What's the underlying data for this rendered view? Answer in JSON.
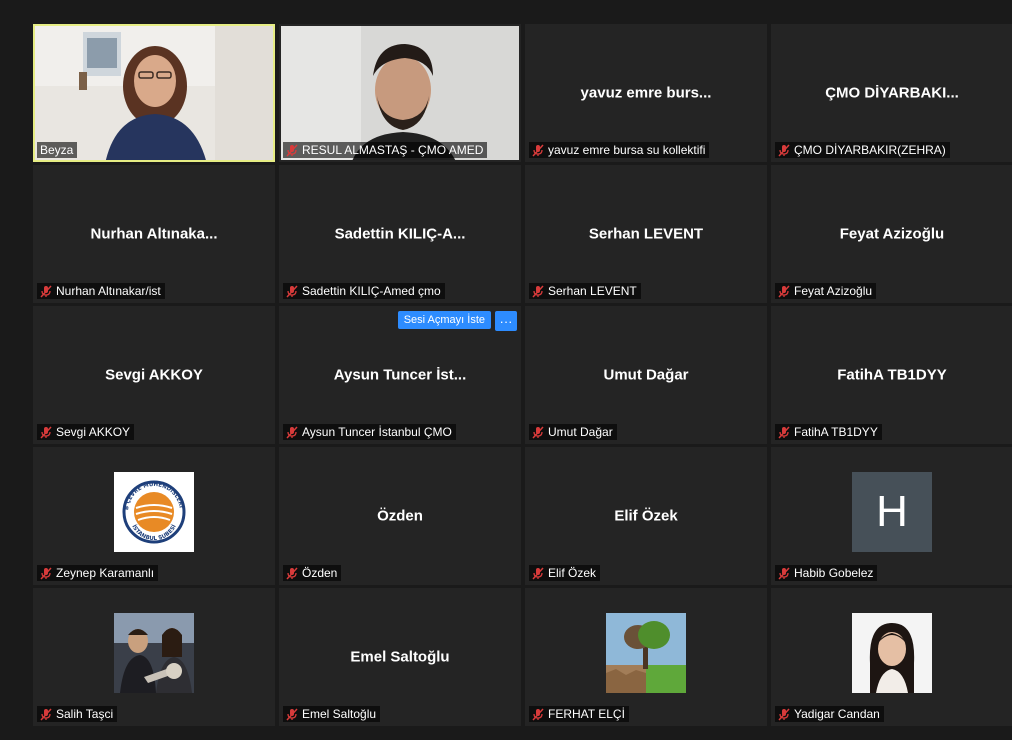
{
  "active_speaker_color": "#e6ed84",
  "accent_color": "#2d8cff",
  "mic_muted_color": "#d83b3b",
  "tiles": [
    {
      "id": "t0",
      "center": "",
      "label": "Beyza",
      "muted": false,
      "kind": "video-woman"
    },
    {
      "id": "t1",
      "center": "",
      "label": "RESUL ALMASTAŞ - ÇMO AMED",
      "muted": true,
      "kind": "video-man"
    },
    {
      "id": "t2",
      "center": "yavuz emre burs...",
      "label": "yavuz emre bursa su kollektifi",
      "muted": true
    },
    {
      "id": "t3",
      "center": "ÇMO  DİYARBAKI...",
      "label": "ÇMO DİYARBAKIR(ZEHRA)",
      "muted": true
    },
    {
      "id": "t4",
      "center": "Nurhan  Altınaka...",
      "label": "Nurhan Altınakar/ist",
      "muted": true
    },
    {
      "id": "t5",
      "center": "Sadettin  KILIÇ-A...",
      "label": "Sadettin KILIÇ-Amed çmo",
      "muted": true
    },
    {
      "id": "t6",
      "center": "Serhan LEVENT",
      "label": "Serhan LEVENT",
      "muted": true
    },
    {
      "id": "t7",
      "center": "Feyat Azizoğlu",
      "label": "Feyat Azizoğlu",
      "muted": true
    },
    {
      "id": "t8",
      "center": "Sevgi AKKOY",
      "label": "Sevgi AKKOY",
      "muted": true
    },
    {
      "id": "t9",
      "center": "Aysun Tuncer  İst...",
      "label": "Aysun Tuncer İstanbul ÇMO",
      "muted": true
    },
    {
      "id": "t10",
      "center": "Umut Dağar",
      "label": "Umut Dağar",
      "muted": true
    },
    {
      "id": "t11",
      "center": "FatihA TB1DYY",
      "label": "FatihA TB1DYY",
      "muted": true
    },
    {
      "id": "t12",
      "center": "",
      "label": "Zeynep Karamanlı",
      "muted": true,
      "kind": "logo"
    },
    {
      "id": "t13",
      "center": "Özden",
      "label": "Özden",
      "muted": true
    },
    {
      "id": "t14",
      "center": "Elif Özek",
      "label": "Elif Özek",
      "muted": true
    },
    {
      "id": "t15",
      "center": "",
      "label": "Habib Gobelez",
      "muted": true,
      "kind": "avatar-h"
    },
    {
      "id": "t16",
      "center": "",
      "label": "Salih Taşci",
      "muted": true,
      "kind": "photo-guitar"
    },
    {
      "id": "t17",
      "center": "Emel Saltoğlu",
      "label": "Emel Saltoğlu",
      "muted": true
    },
    {
      "id": "t18",
      "center": "",
      "label": "FERHAT ELÇİ",
      "muted": true,
      "kind": "photo-tree"
    },
    {
      "id": "t19",
      "center": "",
      "label": "Yadigar Candan",
      "muted": true,
      "kind": "photo-woman"
    }
  ],
  "request_unmute_label": "Sesi Açmayı İste",
  "more_label": "···",
  "avatar_initial": "H",
  "logo_text_top": "TMMOB ÇEVRE MÜHENDİSLERİ ODASI",
  "logo_text_bottom": "İSTANBUL ŞUBESİ"
}
